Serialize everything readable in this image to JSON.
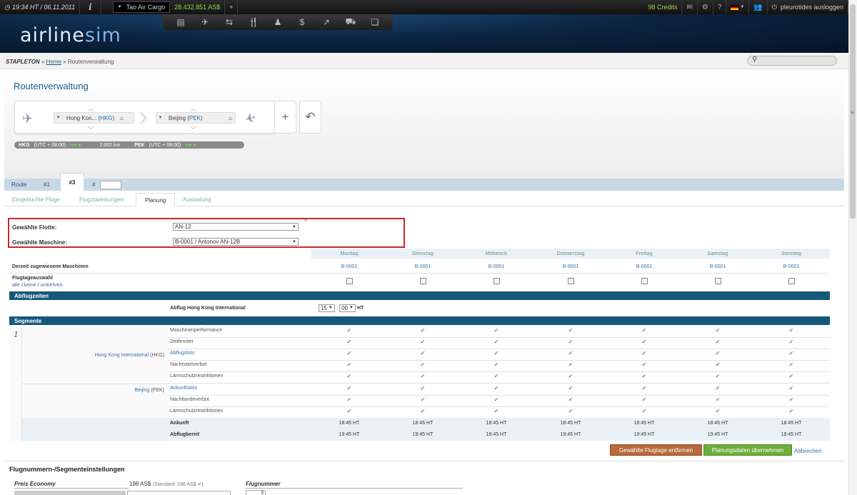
{
  "topbar": {
    "datetime": "19:34 HT / 06.11.2011",
    "info_label": "i",
    "airline_name": "Tao Air Cargo",
    "balance": "28.432.851 AS$",
    "add": "+",
    "credits": "98 Credits",
    "logout": "pleurotides ausloggen"
  },
  "logo": {
    "part1": "airline",
    "part2": "sim"
  },
  "nav_icons": [
    "fleet-icon",
    "plane-icon",
    "route-icon",
    "service-icon",
    "staff-icon",
    "finance-icon",
    "statistics-icon",
    "cargo-icon",
    "glass-icon"
  ],
  "breadcrumb": {
    "company": "STAPLETON",
    "sep1": " » ",
    "home": "Home",
    "sep2": " » ",
    "current": "Routenverwaltung"
  },
  "page": {
    "title": "Routenverwaltung"
  },
  "route": {
    "origin_name": "Hong Kon...",
    "origin_code": "HKG",
    "dest_name": "Beijing",
    "dest_code": "PEK",
    "add_btn": "+",
    "undo_btn": "↶"
  },
  "infobar": {
    "origin_code": "HKG",
    "origin_tz": "(UTC + 08:00)",
    "distance": "2.002 km",
    "dest_code": "PEK",
    "dest_tz": "(UTC + 08:00)"
  },
  "tabs": {
    "route": "Route",
    "t1": "#1",
    "t3": "#3",
    "hash": "#"
  },
  "subtabs": {
    "booked": "Eingebuchte Flüge",
    "assign": "Flugzuweisungen",
    "plan": "Planung",
    "load": "Auslastung"
  },
  "fleet": {
    "fleet_label": "Gewählte Flotte:",
    "fleet_value": "AN-12",
    "machine_label": "Gewählte Maschine:",
    "machine_value": "B-0001 / Antonov AN-12B",
    "caret": "^"
  },
  "days": [
    "Montag",
    "Dienstag",
    "Mittwoch",
    "Donnerstag",
    "Freitag",
    "Samstag",
    "Sonntag"
  ],
  "assigned": {
    "label": "Derzeit zugewiesene Maschinen",
    "values": [
      "B-0001",
      "B-0001",
      "B-0001",
      "B-0001",
      "B-0001",
      "B-0001",
      "B-0001"
    ]
  },
  "daysel": {
    "label": "Flugtageauswahl",
    "alle": "alle",
    "keine": "keine",
    "umkehren": "umkehren",
    "sep": " / "
  },
  "abflug": {
    "section": "Abflugzeiten",
    "label": "Abflug Hong Kong International",
    "hour": "15",
    "minute": "00",
    "colon": ":",
    "tz": "HT"
  },
  "segments": {
    "section": "Segmente",
    "number": "1",
    "origin_name": "Hong Kong International",
    "origin_code": "(HKG)",
    "dest_name": "Beijing",
    "dest_code": "(PEK)",
    "criteria": [
      "Maschinenperformance",
      "Zeitfenster",
      "Abflugslots",
      "Nachtstartverbot",
      "Lärmschutzrestriktionen",
      "Ankunftslots",
      "Nachtlandeverbot",
      "Lärmschutzrestriktionen"
    ],
    "check": "✔",
    "arrival_label": "Ankunft",
    "arrival_values": [
      "18:45 HT",
      "18:45 HT",
      "18:45 HT",
      "18:45 HT",
      "18:45 HT",
      "18:45 HT",
      "18:45 HT"
    ],
    "ready_label": "Abflugbereit",
    "ready_values": [
      "19:45 HT",
      "19:45 HT",
      "19:45 HT",
      "19:45 HT",
      "19:45 HT",
      "19:45 HT",
      "19:45 HT"
    ]
  },
  "buttons": {
    "remove": "Gewählte Flugtage entfernen",
    "apply": "Planungsdaten übernehmen",
    "cancel": "Abbrechen"
  },
  "bottom": {
    "title": "Flugnummern-/Segmenteinstellungen",
    "price_label": "Preis Economy",
    "price_value": "198 AS$",
    "price_std": "(Standard: 198 AS$",
    "price_ok": "✔",
    "price_close": ")",
    "flight_label": "Flugnummer",
    "flight_value": "3"
  }
}
